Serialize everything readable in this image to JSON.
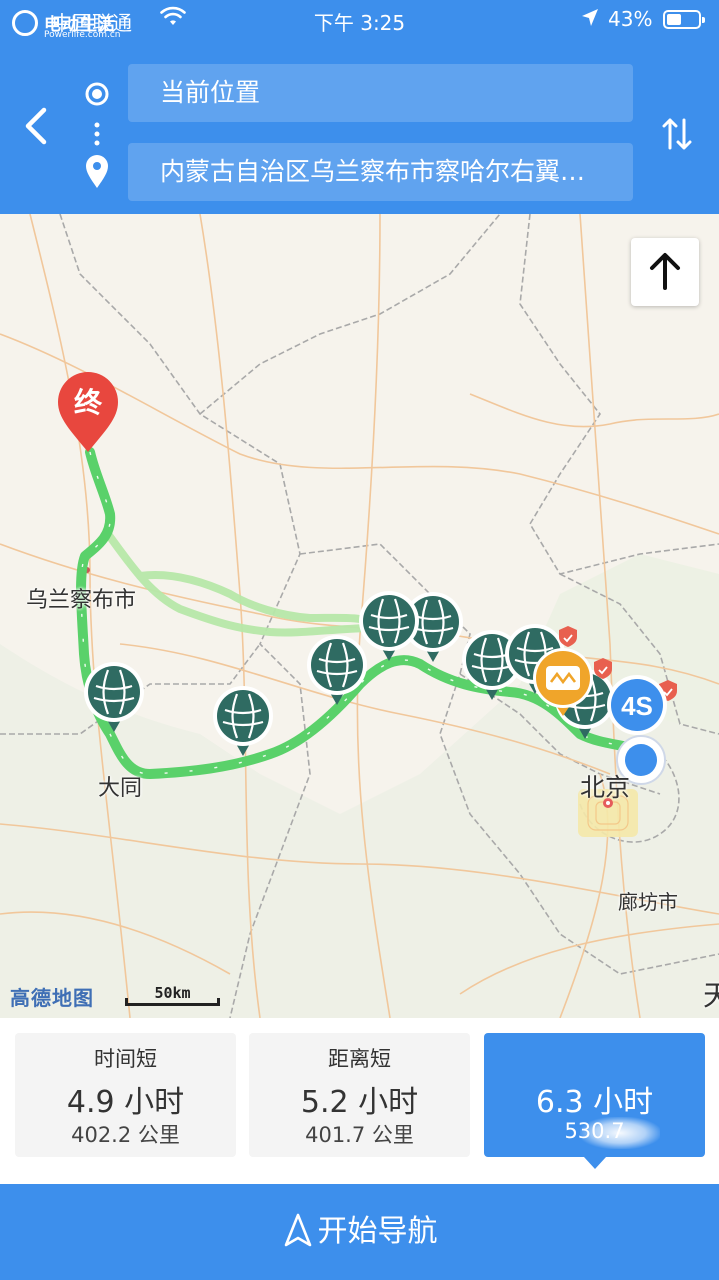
{
  "status_bar": {
    "carrier": "中国联通",
    "time": "下午 3:25",
    "battery": "43%"
  },
  "watermark": {
    "title": "电动生活",
    "url": "Powerlife.com.cn"
  },
  "route_input": {
    "start": "当前位置",
    "destination": "内蒙古自治区乌兰察布市察哈尔右翼…"
  },
  "map": {
    "labels": {
      "ulanqab": "乌兰察布市",
      "datong": "大同",
      "beijing": "北京",
      "langfang": "廊坊市",
      "edge": "天"
    },
    "end_marker": "终",
    "dealer_badge": "4S",
    "logo": "高德地图",
    "scale": "50km",
    "route_color": "#5ad16a",
    "alt_route_color": "#b7e8a9",
    "charger_color": "#2f6b62"
  },
  "routes": [
    {
      "label": "时间短",
      "time": "4.9 小时",
      "distance": "402.2 公里"
    },
    {
      "label": "距离短",
      "time": "5.2 小时",
      "distance": "401.7 公里"
    },
    {
      "label": "",
      "time": "6.3 小时",
      "distance": "530.7",
      "selected": true
    }
  ],
  "start_navigation": "开始导航",
  "colors": {
    "primary": "#3d8fec",
    "end_marker": "#e8473e"
  }
}
